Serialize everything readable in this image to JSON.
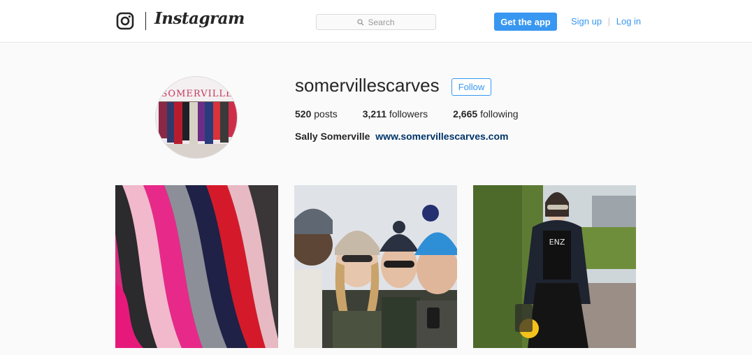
{
  "header": {
    "brand": "Instagram",
    "search": {
      "placeholder": "Search"
    },
    "get_app_label": "Get the app",
    "signup_label": "Sign up",
    "separator": "|",
    "login_label": "Log in"
  },
  "profile": {
    "avatar_sign_text": "SOMERVILLE",
    "username": "somervillescarves",
    "follow_label": "Follow",
    "stats": [
      {
        "count": "520",
        "label": "posts"
      },
      {
        "count": "3,211",
        "label": "followers"
      },
      {
        "count": "2,665",
        "label": "following"
      }
    ],
    "full_name": "Sally Somerville",
    "website": "www.somervillescarves.com"
  },
  "posts": [
    {
      "subject": "folded knitted scarves"
    },
    {
      "subject": "group selfie in winter hats"
    },
    {
      "subject": "woman in black jacket with pom-pom bag"
    }
  ],
  "colors": {
    "accent": "#3897f0",
    "link": "#003569",
    "text": "#262626",
    "background": "#fafafa"
  }
}
